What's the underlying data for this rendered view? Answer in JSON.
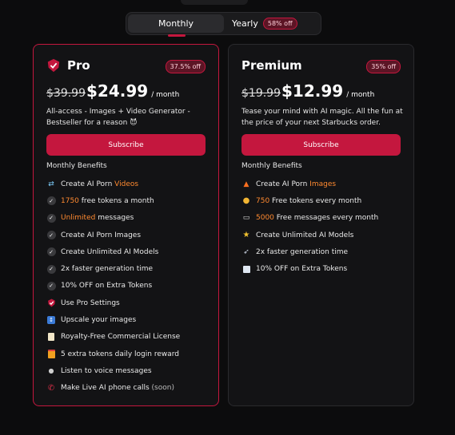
{
  "toggle": {
    "monthly_label": "Monthly",
    "yearly_label": "Yearly",
    "yearly_badge": "58% off",
    "selected": "Monthly"
  },
  "colors": {
    "accent": "#c4173e",
    "highlight": "#ff8a30",
    "background": "#0c0c0d"
  },
  "pro": {
    "title": "Pro",
    "title_icon": "shield-check-icon",
    "discount_badge": "37.5% off",
    "old_price": "$39.99",
    "price": "$24.99",
    "period": "/ month",
    "description": "All-access - Images + Video Generator - Bestseller for a reason 😈",
    "subscribe_label": "Subscribe",
    "benefits_title": "Monthly Benefits",
    "benefits": [
      {
        "icon": "swap-icon",
        "pre": "Create AI Porn ",
        "hl": "Videos",
        "post": "",
        "note": ""
      },
      {
        "icon": "check-icon",
        "pre": "",
        "hl": "1750",
        "post": " free tokens a month",
        "note": ""
      },
      {
        "icon": "check-icon",
        "pre": "",
        "hl": "Unlimited",
        "post": " messages",
        "note": ""
      },
      {
        "icon": "check-icon",
        "pre": "Create AI Porn Images",
        "hl": "",
        "post": "",
        "note": ""
      },
      {
        "icon": "check-icon",
        "pre": "Create Unlimited AI Models",
        "hl": "",
        "post": "",
        "note": ""
      },
      {
        "icon": "check-icon",
        "pre": "2x faster generation time",
        "hl": "",
        "post": "",
        "note": ""
      },
      {
        "icon": "check-icon",
        "pre": "10% OFF on Extra Tokens",
        "hl": "",
        "post": "",
        "note": ""
      },
      {
        "icon": "shield-check-icon",
        "pre": "Use Pro Settings",
        "hl": "",
        "post": "",
        "note": ""
      },
      {
        "icon": "upscale-icon",
        "pre": "Upscale your images",
        "hl": "",
        "post": "",
        "note": ""
      },
      {
        "icon": "license-icon",
        "pre": "Royalty-Free Commercial License",
        "hl": "",
        "post": "",
        "note": ""
      },
      {
        "icon": "gift-icon",
        "pre": "5 extra tokens daily login reward",
        "hl": "",
        "post": "",
        "note": ""
      },
      {
        "icon": "microphone-icon",
        "pre": "Listen to voice messages",
        "hl": "",
        "post": "",
        "note": ""
      },
      {
        "icon": "phone-icon",
        "pre": "Make Live AI phone calls ",
        "hl": "",
        "post": "",
        "note": "(soon)"
      }
    ]
  },
  "premium": {
    "title": "Premium",
    "discount_badge": "35% off",
    "old_price": "$19.99",
    "price": "$12.99",
    "period": "/ month",
    "description": "Tease your mind with AI magic. All the fun at the price of your next Starbucks order.",
    "subscribe_label": "Subscribe",
    "benefits_title": "Monthly Benefits",
    "benefits": [
      {
        "icon": "fire-icon",
        "pre": "Create AI Porn ",
        "hl": "Images",
        "post": "",
        "note": ""
      },
      {
        "icon": "coins-icon",
        "pre": "",
        "hl": "750",
        "post": " Free tokens every month",
        "note": ""
      },
      {
        "icon": "chat-icon",
        "pre": "",
        "hl": "5000",
        "post": " Free messages every month",
        "note": ""
      },
      {
        "icon": "star-icon",
        "pre": "Create Unlimited AI Models",
        "hl": "",
        "post": "",
        "note": ""
      },
      {
        "icon": "rocket-icon",
        "pre": "2x faster generation time",
        "hl": "",
        "post": "",
        "note": ""
      },
      {
        "icon": "discount-icon",
        "pre": "10% OFF on Extra Tokens",
        "hl": "",
        "post": "",
        "note": ""
      }
    ]
  }
}
